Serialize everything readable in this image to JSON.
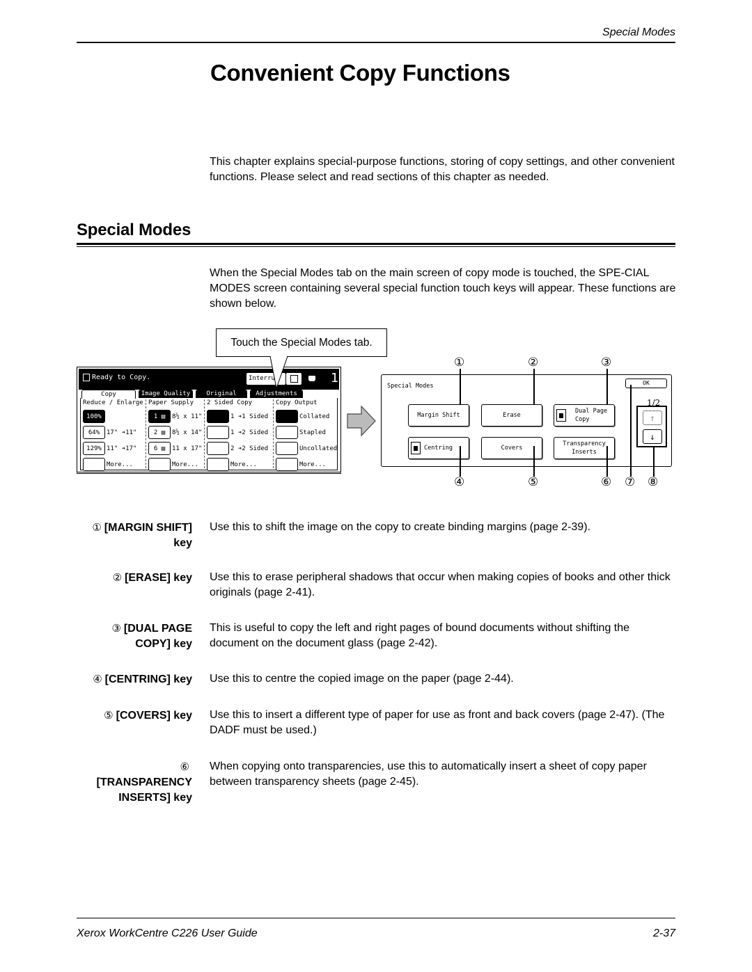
{
  "header": {
    "running_title": "Special Modes"
  },
  "chapter": {
    "title": "Convenient Copy Functions",
    "intro": "This chapter explains special-purpose functions, storing of copy settings, and other convenient functions. Please select and read sections of this chapter as needed."
  },
  "section": {
    "title": "Special Modes",
    "body": "When the Special Modes tab on the main screen of copy mode is touched, the SPE-CIAL MODES screen containing several special function touch keys will appear. These functions are shown below."
  },
  "figure": {
    "callout": "Touch the Special Modes tab.",
    "copy_screen": {
      "status": "Ready to Copy.",
      "interrupt_label": "Interru",
      "copy_count": "1",
      "tabs": [
        "Copy",
        "Image Quality",
        "Original",
        "Adjustments"
      ],
      "columns": [
        {
          "title": "Reduce / Enlarge",
          "rows": [
            {
              "button": "100%",
              "option": "",
              "selected": true
            },
            {
              "button": "64%",
              "option": "17\" ➔11\"",
              "selected": false
            },
            {
              "button": "129%",
              "option": "11\" ➔17\"",
              "selected": false
            },
            {
              "button": "",
              "option": "More...",
              "selected": false
            }
          ]
        },
        {
          "title": "Paper Supply",
          "rows": [
            {
              "button": "1 ▤",
              "option": "8½ x 11\"",
              "selected": true
            },
            {
              "button": "2 ▤",
              "option": "8½ x 14\"",
              "selected": false
            },
            {
              "button": "6 ▤",
              "option": "11 x 17\"",
              "selected": false
            },
            {
              "button": "",
              "option": "More...",
              "selected": false
            }
          ]
        },
        {
          "title": "2 Sided Copy",
          "rows": [
            {
              "button": "",
              "option": "1 ➔1 Sided",
              "selected": true
            },
            {
              "button": "",
              "option": "1 ➔2 Sided",
              "selected": false
            },
            {
              "button": "",
              "option": "2 ➔2 Sided",
              "selected": false
            },
            {
              "button": "",
              "option": "More...",
              "selected": false
            }
          ]
        },
        {
          "title": "Copy Output",
          "rows": [
            {
              "button": "",
              "option": "Collated",
              "selected": true
            },
            {
              "button": "",
              "option": "Stapled",
              "selected": false
            },
            {
              "button": "",
              "option": "Uncollated",
              "selected": false
            },
            {
              "button": "",
              "option": "More...",
              "selected": false
            }
          ]
        }
      ]
    },
    "special_screen": {
      "title": "Special Modes",
      "ok_label": "OK",
      "page_indicator": "1/2",
      "buttons": [
        {
          "label": "Margin Shift",
          "icon": ""
        },
        {
          "label": "Erase",
          "icon": ""
        },
        {
          "label": "Dual Page Copy",
          "icon": "dual-page-icon"
        },
        {
          "label": "Centring",
          "icon": "centring-icon"
        },
        {
          "label": "Covers",
          "icon": ""
        },
        {
          "label": "Transparency Inserts",
          "icon": ""
        }
      ],
      "scroll_up_icon": "↑",
      "scroll_down_icon": "↓"
    },
    "callout_numbers": [
      "①",
      "②",
      "③",
      "④",
      "⑤",
      "⑥",
      "⑦",
      "⑧"
    ]
  },
  "definitions": [
    {
      "num": "①",
      "term": "[MARGIN SHIFT] key",
      "desc": "Use this to shift the image on the copy to create binding margins (page 2-39)."
    },
    {
      "num": "②",
      "term": "[ERASE] key",
      "desc": "Use this to erase peripheral shadows that occur when making copies of books and other thick originals (page 2-41)."
    },
    {
      "num": "③",
      "term": "[DUAL PAGE COPY] key",
      "desc": "This is useful to copy the left and right pages of bound documents without shifting the document on the document glass (page 2-42)."
    },
    {
      "num": "④",
      "term": "[CENTRING] key",
      "desc": "Use this to centre the copied image on the paper (page 2-44)."
    },
    {
      "num": "⑤",
      "term": "[COVERS] key",
      "desc": "Use this to insert a different type of paper for use as front and back covers (page 2-47). (The DADF must be used.)"
    },
    {
      "num": "⑥",
      "term": "[TRANSPARENCY INSERTS] key",
      "desc": "When copying onto transparencies, use this to automatically insert a sheet of copy paper between transparency sheets (page 2-45)."
    }
  ],
  "footer": {
    "guide_title": "Xerox WorkCentre C226 User Guide",
    "page_number": "2-37"
  }
}
